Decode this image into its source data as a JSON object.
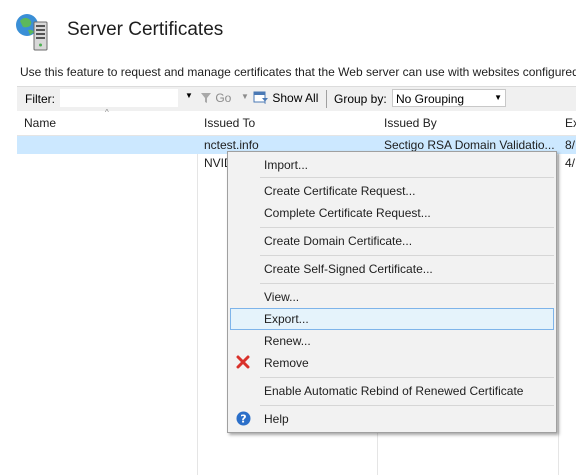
{
  "page": {
    "title": "Server Certificates",
    "description": "Use this feature to request and manage certificates that the Web server can use with websites configured f"
  },
  "toolbar": {
    "filter_label": "Filter:",
    "filter_value": "",
    "go_label": "Go",
    "show_all_label": "Show All",
    "group_by_label": "Group by:",
    "group_by_value": "No Grouping"
  },
  "grid": {
    "columns": [
      "Name",
      "Issued To",
      "Issued By",
      "Ex"
    ],
    "rows": [
      {
        "name": "",
        "issued_to": "nctest.info",
        "issued_by": "Sectigo RSA Domain Validatio...",
        "expiration": "8/"
      },
      {
        "name": "",
        "issued_to": "NVID",
        "issued_by": "",
        "expiration": "4/"
      }
    ]
  },
  "context_menu": {
    "items": [
      {
        "label": "Import..."
      },
      {
        "label": "Create Certificate Request..."
      },
      {
        "label": "Complete Certificate Request..."
      },
      {
        "label": "Create Domain Certificate..."
      },
      {
        "label": "Create Self-Signed Certificate..."
      },
      {
        "label": "View..."
      },
      {
        "label": "Export..."
      },
      {
        "label": "Renew..."
      },
      {
        "label": "Remove",
        "icon": "red-x-icon"
      },
      {
        "label": "Enable Automatic Rebind of Renewed Certificate"
      },
      {
        "label": "Help",
        "icon": "help-icon"
      }
    ],
    "hovered": "Export..."
  },
  "colors": {
    "selection": "#cce8ff",
    "menu_hover": "#e5f3fb",
    "menu_hover_border": "#7eb4ea",
    "remove_icon": "#d9312b",
    "help_icon": "#2b6fc9"
  }
}
